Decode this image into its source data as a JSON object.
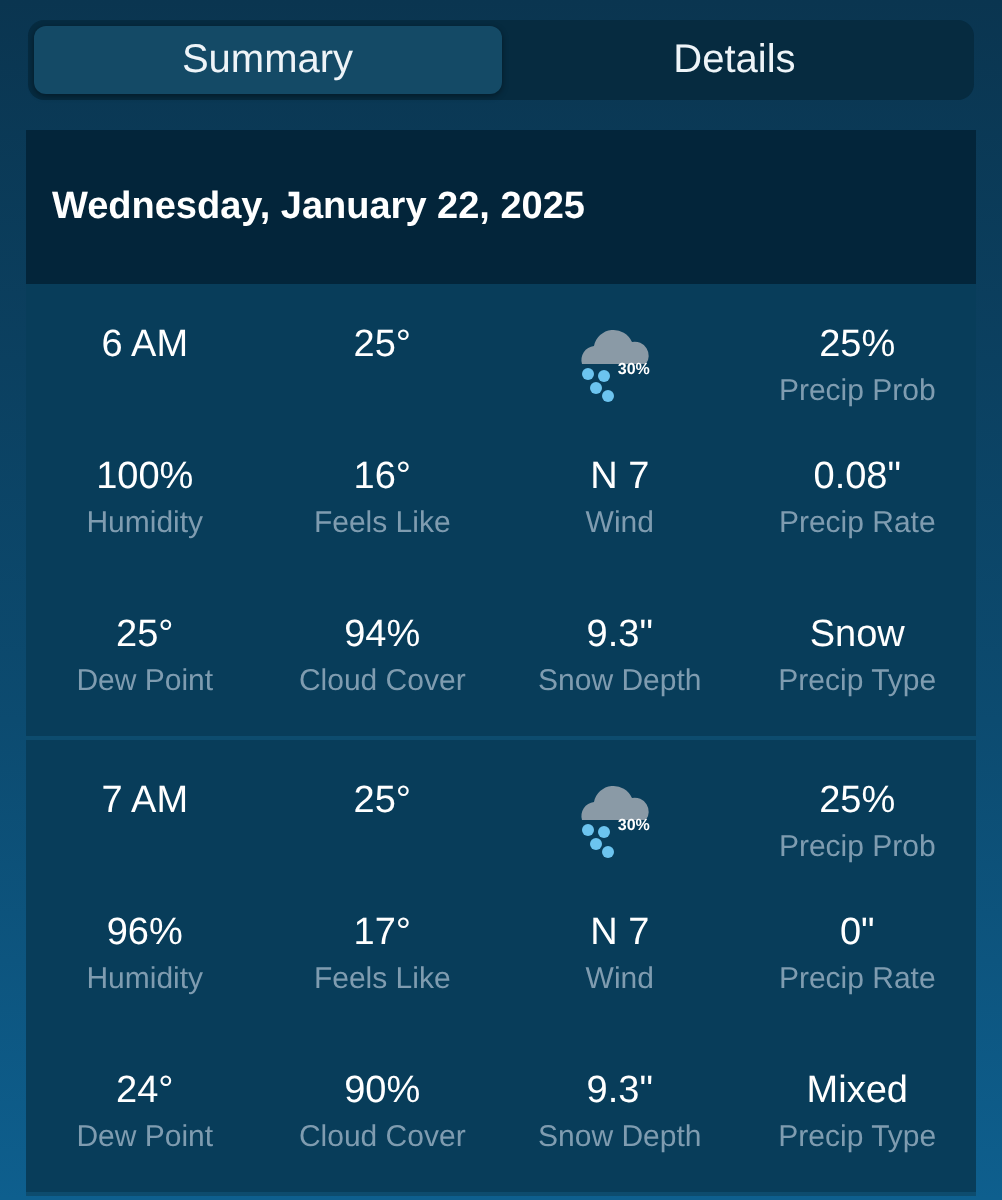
{
  "tabs": [
    {
      "label": "Summary",
      "selected": true
    },
    {
      "label": "Details",
      "selected": false
    }
  ],
  "date": "Wednesday, January 22, 2025",
  "hours": [
    {
      "rows": [
        [
          {
            "kind": "text",
            "value": "6 AM"
          },
          {
            "kind": "text",
            "value": "25°"
          },
          {
            "kind": "weather",
            "chance": "30%"
          },
          {
            "kind": "text",
            "value": "25%",
            "label": "Precip Prob"
          }
        ],
        [
          {
            "kind": "text",
            "value": "100%",
            "label": "Humidity"
          },
          {
            "kind": "text",
            "value": "16°",
            "label": "Feels Like"
          },
          {
            "kind": "text",
            "value": "N 7",
            "label": "Wind"
          },
          {
            "kind": "text",
            "value": "0.08\"",
            "label": "Precip Rate"
          }
        ],
        [
          {
            "kind": "text",
            "value": "25°",
            "label": "Dew Point"
          },
          {
            "kind": "text",
            "value": "94%",
            "label": "Cloud Cover"
          },
          {
            "kind": "text",
            "value": "9.3\"",
            "label": "Snow Depth"
          },
          {
            "kind": "text",
            "value": "Snow",
            "label": "Precip Type"
          }
        ]
      ]
    },
    {
      "rows": [
        [
          {
            "kind": "text",
            "value": "7 AM"
          },
          {
            "kind": "text",
            "value": "25°"
          },
          {
            "kind": "weather",
            "chance": "30%"
          },
          {
            "kind": "text",
            "value": "25%",
            "label": "Precip Prob"
          }
        ],
        [
          {
            "kind": "text",
            "value": "96%",
            "label": "Humidity"
          },
          {
            "kind": "text",
            "value": "17°",
            "label": "Feels Like"
          },
          {
            "kind": "text",
            "value": "N 7",
            "label": "Wind"
          },
          {
            "kind": "text",
            "value": "0\"",
            "label": "Precip Rate"
          }
        ],
        [
          {
            "kind": "text",
            "value": "24°",
            "label": "Dew Point"
          },
          {
            "kind": "text",
            "value": "90%",
            "label": "Cloud Cover"
          },
          {
            "kind": "text",
            "value": "9.3\"",
            "label": "Snow Depth"
          },
          {
            "kind": "text",
            "value": "Mixed",
            "label": "Precip Type"
          }
        ]
      ]
    }
  ]
}
